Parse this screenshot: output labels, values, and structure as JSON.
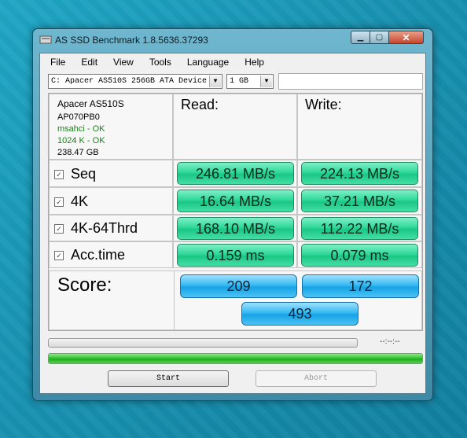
{
  "window": {
    "title": "AS SSD Benchmark 1.8.5636.37293"
  },
  "menu": [
    "File",
    "Edit",
    "View",
    "Tools",
    "Language",
    "Help"
  ],
  "drive_select": {
    "value": "C: Apacer AS510S 256GB ATA Device"
  },
  "size_select": {
    "value": "1 GB"
  },
  "device": {
    "name": "Apacer AS510S",
    "firmware": "AP070PB0",
    "driver_status": "msahci - OK",
    "alignment_status": "1024 K - OK",
    "capacity": "238.47 GB"
  },
  "columns": {
    "read": "Read:",
    "write": "Write:"
  },
  "tests": [
    {
      "label": "Seq",
      "read": "246.81 MB/s",
      "write": "224.13 MB/s"
    },
    {
      "label": "4K",
      "read": "16.64 MB/s",
      "write": "37.21 MB/s"
    },
    {
      "label": "4K-64Thrd",
      "read": "168.10 MB/s",
      "write": "112.22 MB/s"
    },
    {
      "label": "Acc.time",
      "read": "0.159 ms",
      "write": "0.079 ms"
    }
  ],
  "score": {
    "label": "Score:",
    "read": "209",
    "write": "172",
    "total": "493"
  },
  "progress": {
    "time": "--:--:--",
    "overall_fraction": 1.0
  },
  "buttons": {
    "start": "Start",
    "abort": "Abort"
  },
  "colors": {
    "result_green": "#2fd89a",
    "score_blue": "#16a3e6",
    "progress_green": "#2cc12a"
  }
}
